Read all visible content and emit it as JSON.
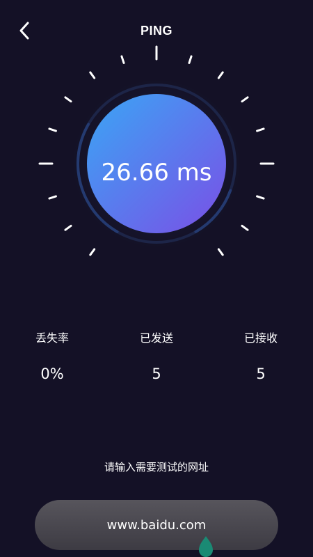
{
  "header": {
    "title": "PING",
    "back_icon": "chevron-left-icon"
  },
  "gauge": {
    "value_text": "26.66 ms",
    "gradient_start": "#3aa6f5",
    "gradient_end": "#7a4fe6",
    "progress_fraction": 0.3
  },
  "stats": {
    "loss_label": "丢失率",
    "loss_value": "0%",
    "sent_label": "已发送",
    "sent_value": "5",
    "received_label": "已接收",
    "received_value": "5"
  },
  "input": {
    "prompt": "请输入需要测试的网址",
    "value": "www.baidu.com",
    "handle_color": "#1a8a74"
  },
  "colors": {
    "background": "#141126",
    "ring": "#1d2a52"
  }
}
